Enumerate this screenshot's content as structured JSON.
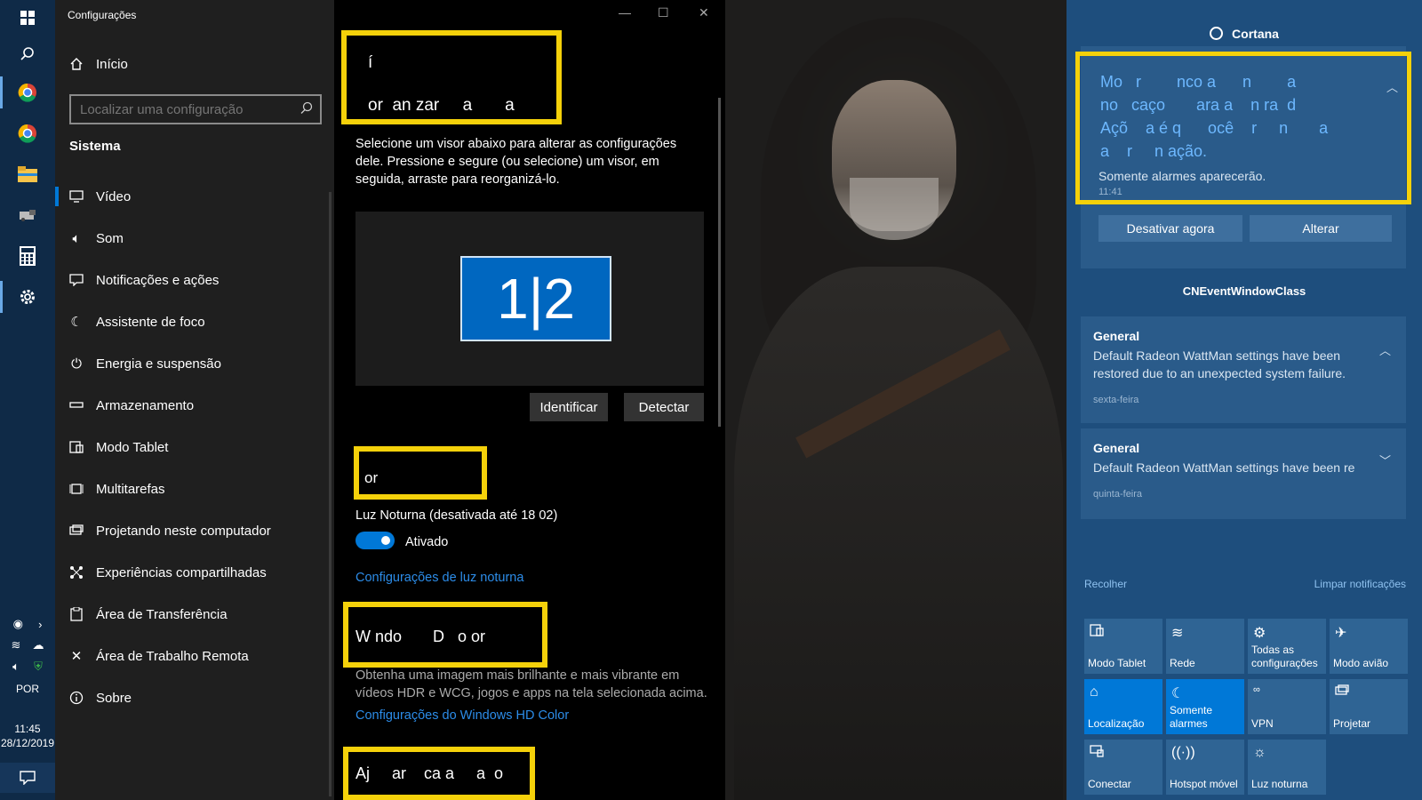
{
  "taskbar": {
    "icons": [
      "windows-start-icon",
      "search-icon",
      "chrome-icon",
      "chrome-icon",
      "file-explorer-icon",
      "app-icon",
      "calculator-icon",
      "settings-gear-icon"
    ],
    "language": "POR",
    "time": "11:45",
    "date": "28/12/2019"
  },
  "settings": {
    "app_title": "Configurações",
    "home_label": "Início",
    "search_placeholder": "Localizar uma configuração",
    "section": "Sistema",
    "nav": [
      {
        "label": "Vídeo",
        "icon": "monitor-icon",
        "selected": true
      },
      {
        "label": "Som",
        "icon": "speaker-icon"
      },
      {
        "label": "Notificações e ações",
        "icon": "notification-icon"
      },
      {
        "label": "Assistente de foco",
        "icon": "moon-icon"
      },
      {
        "label": "Energia e suspensão",
        "icon": "power-icon"
      },
      {
        "label": "Armazenamento",
        "icon": "storage-icon"
      },
      {
        "label": "Modo Tablet",
        "icon": "tablet-icon"
      },
      {
        "label": "Multitarefas",
        "icon": "multitask-icon"
      },
      {
        "label": "Projetando neste computador",
        "icon": "project-icon"
      },
      {
        "label": "Experiências compartilhadas",
        "icon": "share-icon"
      },
      {
        "label": "Área de Transferência",
        "icon": "clipboard-icon"
      },
      {
        "label": "Área de Trabalho Remota",
        "icon": "remote-icon"
      },
      {
        "label": "Sobre",
        "icon": "info-icon"
      }
    ],
    "content": {
      "header1_line1": "í",
      "header1_line2": "or  an zar     a       a",
      "description": "Selecione um visor abaixo para alterar as configurações dele. Pressione e segure (ou selecione) um visor, em seguida, arraste para reorganizá-lo.",
      "monitor_label": "1|2",
      "identify_button": "Identificar",
      "detect_button": "Detectar",
      "header2": "or",
      "night_light_label": "Luz Noturna (desativada até 18 02)",
      "toggle_state": "Ativado",
      "night_light_link": "Configurações de luz noturna",
      "header3": "W ndo       D   o or",
      "hd_description": "Obtenha uma imagem mais brilhante e mais vibrante em vídeos HDR e WCG, jogos e apps na tela selecionada acima.",
      "hd_link": "Configurações do Windows HD Color",
      "header4": "Aj     ar    ca a     a  o"
    }
  },
  "action_center": {
    "cortana_title": "Cortana",
    "focus_lines": [
      "Mo   r        nco a      n        a",
      "no   caço       ara a    n ra  d",
      "Açõ    a é q      ocê    r     n       a",
      "a    r     n ação."
    ],
    "focus_sub": "Somente alarmes aparecerão.",
    "focus_time": "11:41",
    "disable_button": "Desativar agora",
    "change_button": "Alterar",
    "group_title": "CNEventWindowClass",
    "notifications": [
      {
        "title": "General",
        "body": "Default Radeon WattMan settings have been restored due to an unexpected system failure.",
        "date": "sexta-feira"
      },
      {
        "title": "General",
        "body": "Default Radeon WattMan settings have been re",
        "date": "quinta-feira"
      }
    ],
    "collapse_link": "Recolher",
    "clear_link": "Limpar notificações",
    "quick_actions": [
      {
        "label": "Modo Tablet",
        "icon": "tablet-icon",
        "on": false
      },
      {
        "label": "Rede",
        "icon": "wifi-icon",
        "on": false
      },
      {
        "label": "Todas as configurações",
        "icon": "gear-icon",
        "on": false
      },
      {
        "label": "Modo avião",
        "icon": "airplane-icon",
        "on": false
      },
      {
        "label": "Localização",
        "icon": "location-icon",
        "on": true
      },
      {
        "label": "Somente alarmes",
        "icon": "moon-icon",
        "on": true
      },
      {
        "label": "VPN",
        "icon": "vpn-icon",
        "on": false
      },
      {
        "label": "Projetar",
        "icon": "project-icon",
        "on": false
      },
      {
        "label": "Conectar",
        "icon": "connect-icon",
        "on": false
      },
      {
        "label": "Hotspot móvel",
        "icon": "hotspot-icon",
        "on": false
      },
      {
        "label": "Luz noturna",
        "icon": "sun-icon",
        "on": false
      }
    ]
  },
  "colors": {
    "accent": "#0078d7",
    "highlight_box": "#f5d10a",
    "action_center_bg": "#1e4e7d"
  }
}
